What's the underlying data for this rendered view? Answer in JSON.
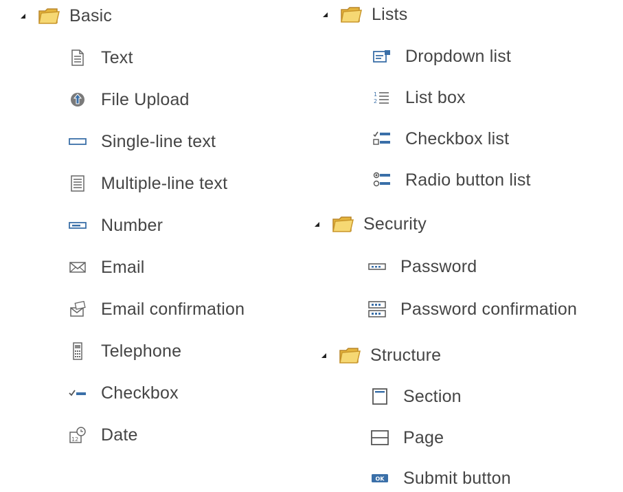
{
  "tree": {
    "basic": {
      "label": "Basic",
      "items": [
        {
          "label": "Text",
          "icon": "text-document-icon"
        },
        {
          "label": "File Upload",
          "icon": "file-upload-icon"
        },
        {
          "label": "Single-line text",
          "icon": "single-line-text-icon"
        },
        {
          "label": "Multiple-line text",
          "icon": "multiple-line-text-icon"
        },
        {
          "label": "Number",
          "icon": "number-icon"
        },
        {
          "label": "Email",
          "icon": "email-icon"
        },
        {
          "label": "Email confirmation",
          "icon": "email-confirmation-icon"
        },
        {
          "label": "Telephone",
          "icon": "telephone-icon"
        },
        {
          "label": "Checkbox",
          "icon": "checkbox-icon"
        },
        {
          "label": "Date",
          "icon": "date-icon"
        }
      ]
    },
    "lists": {
      "label": "Lists",
      "items": [
        {
          "label": "Dropdown list",
          "icon": "dropdown-list-icon"
        },
        {
          "label": "List box",
          "icon": "list-box-icon"
        },
        {
          "label": "Checkbox list",
          "icon": "checkbox-list-icon"
        },
        {
          "label": "Radio button list",
          "icon": "radio-button-list-icon"
        }
      ]
    },
    "security": {
      "label": "Security",
      "items": [
        {
          "label": "Password",
          "icon": "password-icon"
        },
        {
          "label": "Password confirmation",
          "icon": "password-confirmation-icon"
        }
      ]
    },
    "structure": {
      "label": "Structure",
      "items": [
        {
          "label": "Section",
          "icon": "section-icon"
        },
        {
          "label": "Page",
          "icon": "page-icon"
        },
        {
          "label": "Submit button",
          "icon": "submit-button-icon"
        }
      ]
    }
  },
  "colors": {
    "folder": "#f2c94c",
    "folder_edge": "#c9962a",
    "icon_blue": "#3a6fa8",
    "icon_gray": "#6b6b6b",
    "toggle": "#222222"
  }
}
